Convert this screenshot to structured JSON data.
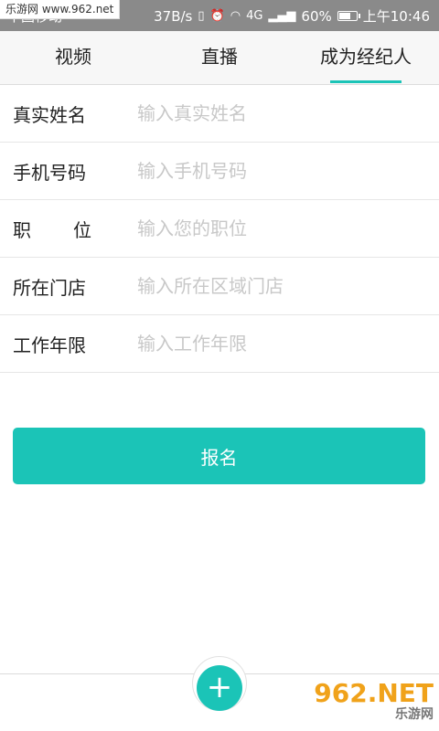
{
  "status_bar": {
    "carrier": "中国移动",
    "speed": "37B/s",
    "signal_badge": "4G",
    "battery": "60%",
    "battery_level": 0.6,
    "time": "上午10:46"
  },
  "watermark_top": "乐游网 www.962.net",
  "tabs": [
    {
      "label": "视频",
      "active": false
    },
    {
      "label": "直播",
      "active": false
    },
    {
      "label": "成为经纪人",
      "active": true
    }
  ],
  "form": {
    "rows": [
      {
        "label": "真实姓名",
        "placeholder": "输入真实姓名"
      },
      {
        "label_chars": [
          "职",
          "位"
        ],
        "label": "职　位"
      },
      {
        "label": "所在门店",
        "placeholder": "输入所在区域门店"
      },
      {
        "label": "工作年限",
        "placeholder": "输入工作年限"
      }
    ],
    "phone_label": "手机号码",
    "phone_placeholder": "输入手机号码",
    "position_placeholder": "输入您的职位"
  },
  "submit_label": "报名",
  "fab_label": "+",
  "watermark_bottom": {
    "big": "962.NET",
    "small": "乐游网"
  },
  "colors": {
    "accent": "#1bc4b7",
    "status_bar": "#8a8a8a"
  }
}
